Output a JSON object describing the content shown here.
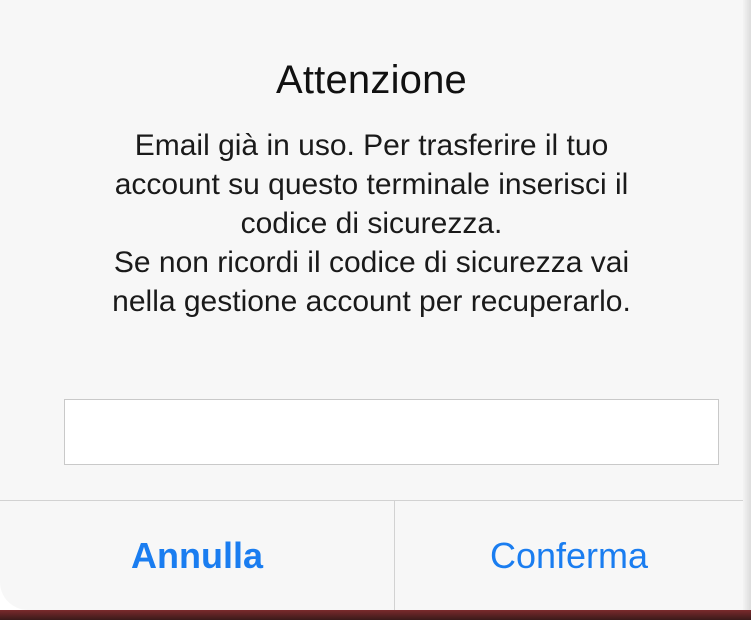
{
  "alert": {
    "title": "Attenzione",
    "message_lines": [
      "Email già in uso. Per trasferire il tuo",
      "account su questo terminale inserisci il",
      "codice di sicurezza.",
      "Se non ricordi il codice di sicurezza vai",
      "nella gestione account per recuperarlo."
    ],
    "input": {
      "value": "",
      "placeholder": ""
    },
    "buttons": {
      "cancel_label": "Annulla",
      "confirm_label": "Conferma"
    }
  },
  "colors": {
    "accent": "#1a7df0",
    "dialog_background": "#f7f7f7",
    "separator": "#d2d2d2"
  }
}
